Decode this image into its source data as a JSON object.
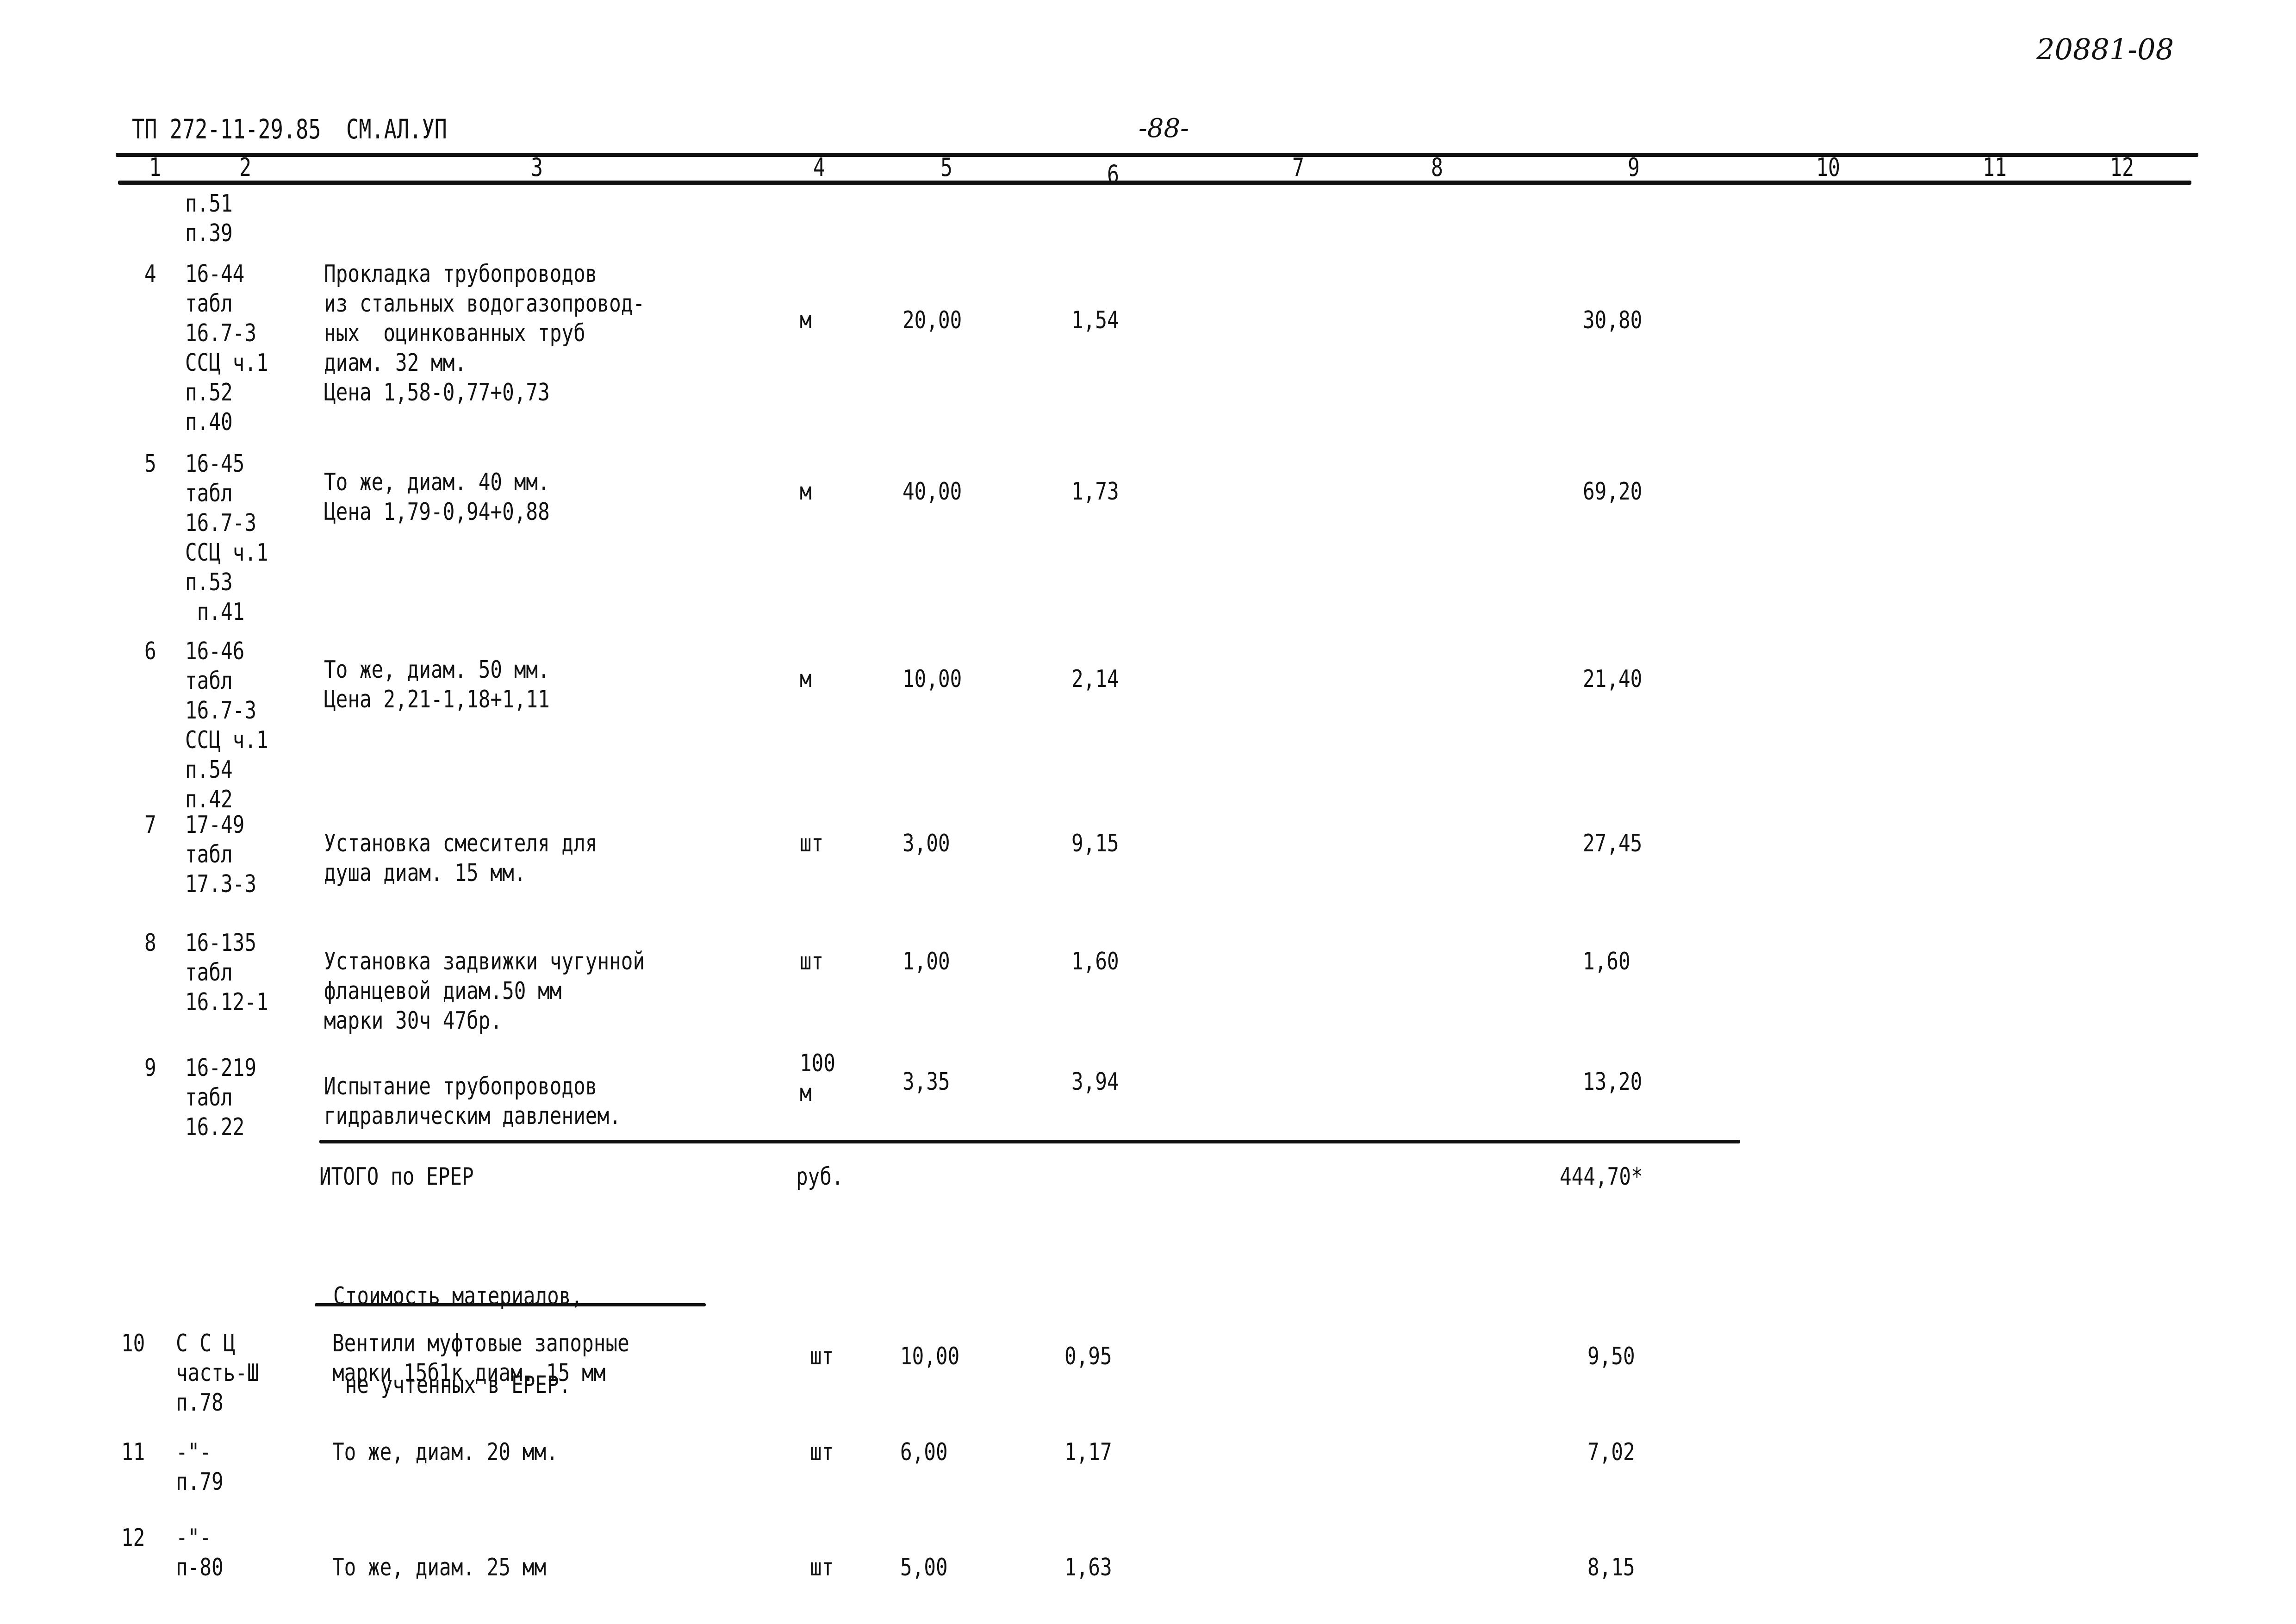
{
  "header": {
    "doc_code": "ТП 272-11-29.85  СМ.АЛ.УП",
    "page_number": "-88-",
    "archive_number": "20881-08"
  },
  "columns": [
    "1",
    "2",
    "3",
    "4",
    "5",
    "6",
    "7",
    "8",
    "9",
    "10",
    "11",
    "12"
  ],
  "continuation": {
    "basis": [
      "п.51",
      "п.39"
    ]
  },
  "rows": [
    {
      "no": "4",
      "basis": [
        "16-44",
        "табл",
        "16.7-3",
        "ССЦ ч.1",
        "п.52",
        "п.40"
      ],
      "description": [
        "Прокладка трубопроводов",
        "из стальных водогазопровод-",
        "ных  оцинкованных труб",
        "диам. 32 мм.",
        "Цена 1,58-0,77+0,73"
      ],
      "unit": [
        "м"
      ],
      "quantity": "20,00",
      "unit_price": "1,54",
      "total": "30,80"
    },
    {
      "no": "5",
      "basis": [
        "16-45",
        "табл",
        "16.7-3",
        "ССЦ ч.1",
        "п.53",
        " п.41"
      ],
      "description": [
        "То же, диам. 40 мм.",
        "Цена 1,79-0,94+0,88"
      ],
      "unit": [
        "м"
      ],
      "quantity": "40,00",
      "unit_price": "1,73",
      "total": "69,20"
    },
    {
      "no": "6",
      "basis": [
        "16-46",
        "табл",
        "16.7-3",
        "ССЦ ч.1",
        "п.54",
        "п.42"
      ],
      "description": [
        "То же, диам. 50 мм.",
        "Цена 2,21-1,18+1,11"
      ],
      "unit": [
        "м"
      ],
      "quantity": "10,00",
      "unit_price": "2,14",
      "total": "21,40"
    },
    {
      "no": "7",
      "basis": [
        "17-49",
        "табл",
        "17.3-3"
      ],
      "description": [
        "Установка смесителя для",
        "душа диам. 15 мм."
      ],
      "unit": [
        "шт"
      ],
      "quantity": "3,00",
      "unit_price": "9,15",
      "total": "27,45"
    },
    {
      "no": "8",
      "basis": [
        "16-135",
        "табл",
        "16.12-1"
      ],
      "description": [
        "Установка задвижки чугунной",
        "фланцевой диам.50 мм",
        "марки 30ч 47бр."
      ],
      "unit": [
        "шт"
      ],
      "quantity": "1,00",
      "unit_price": "1,60",
      "total": "1,60"
    },
    {
      "no": "9",
      "basis": [
        "16-219",
        "табл",
        "16.22"
      ],
      "description": [
        "Испытание трубопроводов",
        "гидравлическим давлением."
      ],
      "unit": [
        "100",
        "м"
      ],
      "quantity": "3,35",
      "unit_price": "3,94",
      "total": "13,20"
    }
  ],
  "subtotal": {
    "label": "ИТОГО по ЕРЕР",
    "unit": "руб.",
    "total": "444,70*"
  },
  "materials_heading": [
    "Стоимость материалов,",
    " не учтенных в ЕРЕР."
  ],
  "material_rows": [
    {
      "no": "10",
      "basis": [
        "С С Ц",
        "часть-Ш",
        "п.78"
      ],
      "description": [
        "Вентили муфтовые запорные",
        "марки 15б1к диам. 15 мм"
      ],
      "unit": [
        "шт"
      ],
      "quantity": "10,00",
      "unit_price": "0,95",
      "total": "9,50"
    },
    {
      "no": "11",
      "basis": [
        "-\"-",
        "п.79"
      ],
      "description": [
        "То же, диам. 20 мм."
      ],
      "unit": [
        "шт"
      ],
      "quantity": "6,00",
      "unit_price": "1,17",
      "total": "7,02"
    },
    {
      "no": "12",
      "basis": [
        "-\"-",
        "п-80"
      ],
      "description": [
        "",
        "То же, диам. 25 мм"
      ],
      "unit": [
        "",
        "шт"
      ],
      "quantity": "5,00",
      "unit_price": "1,63",
      "total": "8,15"
    }
  ]
}
